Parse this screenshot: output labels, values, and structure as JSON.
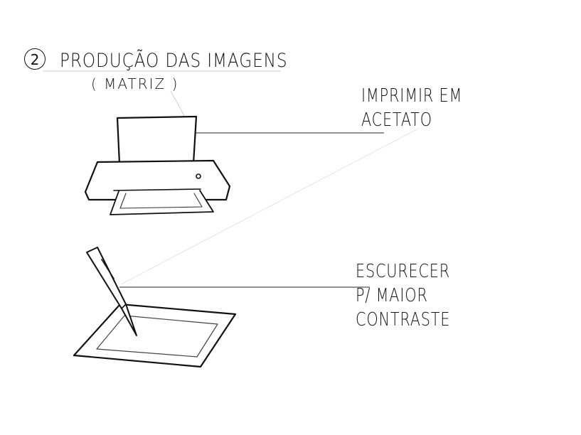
{
  "section": {
    "number": "2",
    "title": "PRODUÇÃO DAS IMAGENS",
    "subtitle": "( MATRIZ )"
  },
  "steps": [
    {
      "icon": "printer-icon",
      "lines": [
        "IMPRIMIR EM",
        "ACETATO"
      ]
    },
    {
      "icon": "pen-on-tablet-icon",
      "lines": [
        "ESCURECER",
        "P/ MAIOR",
        "CONTRASTE"
      ]
    }
  ]
}
